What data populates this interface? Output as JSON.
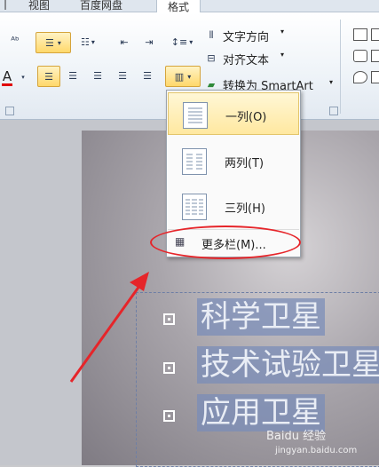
{
  "tabs": [
    {
      "label": "视图"
    },
    {
      "label": "百度网盘"
    },
    {
      "label": "格式"
    }
  ],
  "ribbon": {
    "text_direction": "文字方向",
    "align_text": "对齐文本",
    "convert_smartart": "转换为 SmartArt",
    "dropdown_glyph": "▾"
  },
  "menu": {
    "items": [
      {
        "label": "一列(O)"
      },
      {
        "label": "两列(T)"
      },
      {
        "label": "三列(H)"
      }
    ],
    "more": "更多栏(M)..."
  },
  "slide": {
    "bullets": [
      "科学卫星",
      "技术试验卫星",
      "应用卫星"
    ]
  },
  "watermark": "Baidu 经验",
  "watermark_url": "jingyan.baidu.com",
  "colors": {
    "annotation": "#e6252a",
    "selection": "#ffd86b"
  }
}
